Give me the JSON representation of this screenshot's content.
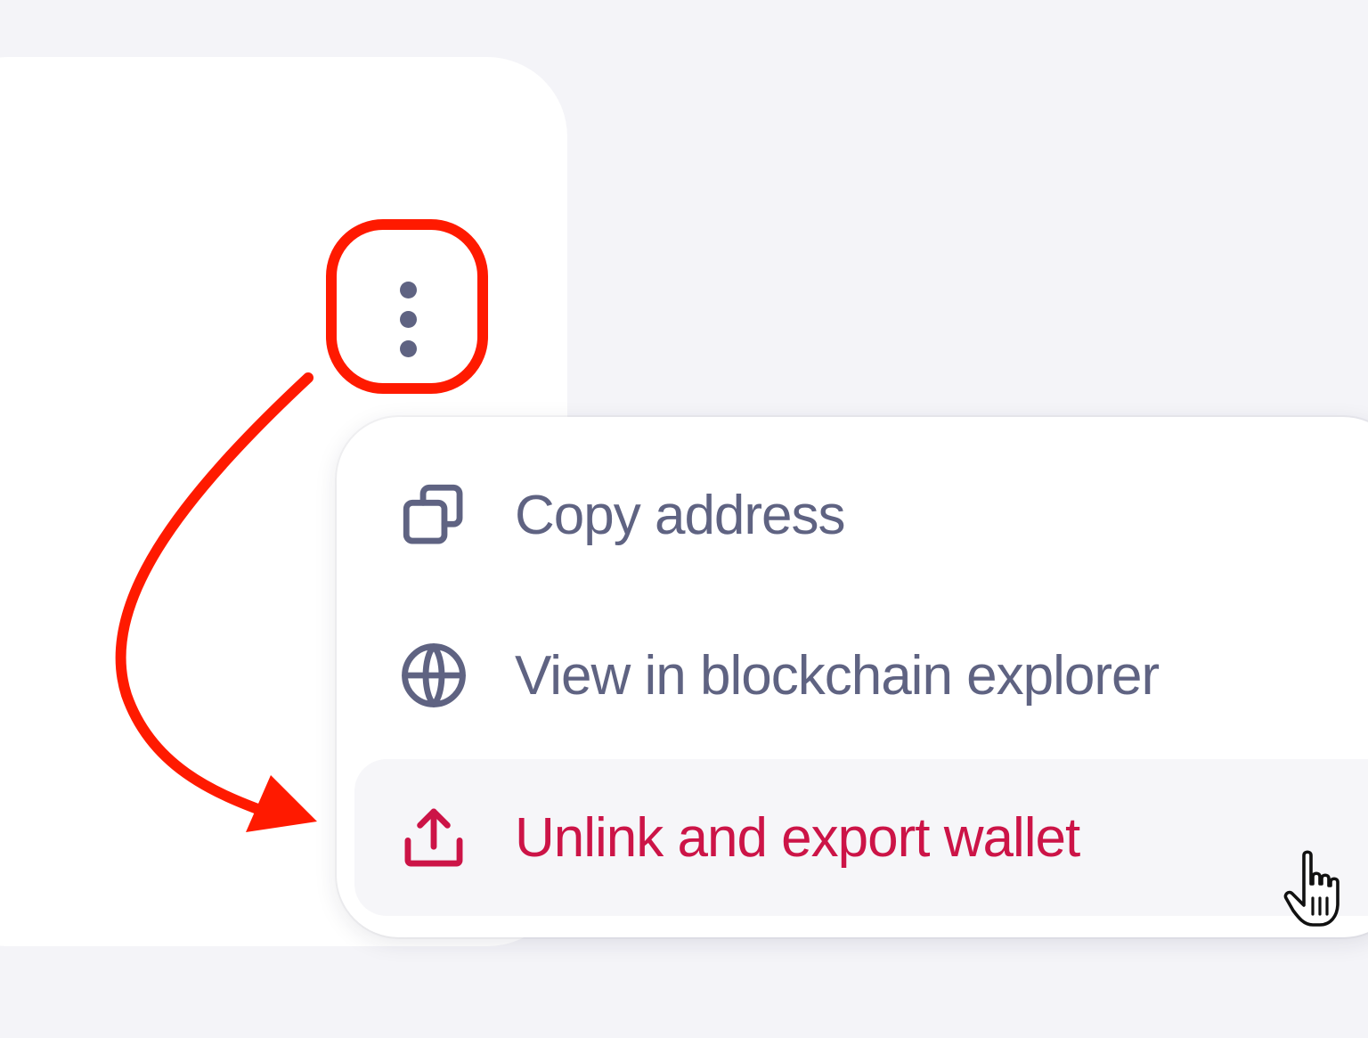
{
  "menu": {
    "items": [
      {
        "label": "Copy address",
        "icon": "copy-icon"
      },
      {
        "label": "View in blockchain explorer",
        "icon": "globe-icon"
      },
      {
        "label": "Unlink and export wallet",
        "icon": "upload-icon",
        "state": "hover"
      }
    ]
  },
  "colors": {
    "page_background": "#f4f4f8",
    "menu_text": "#5f6382",
    "danger_text": "#cc1447",
    "annotation": "#ff1a00"
  },
  "annotation": {
    "highlight": "more-options-button",
    "arrow_target": "unlink-export-wallet-item"
  }
}
